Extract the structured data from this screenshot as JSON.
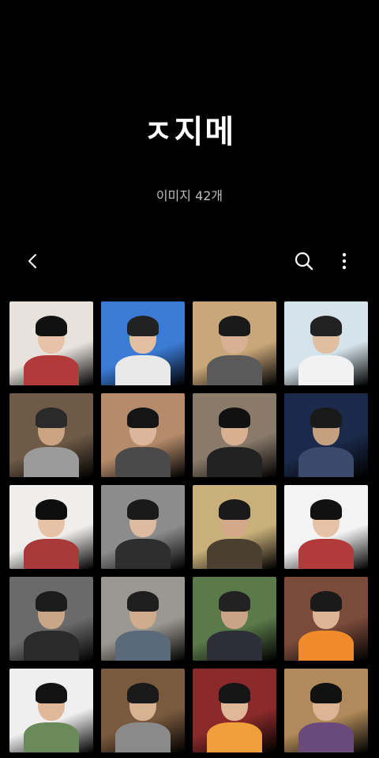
{
  "album": {
    "title": "ㅈ지메",
    "count_label": "이미지 42개"
  },
  "toolbar": {
    "back_icon": "back-arrow-icon",
    "search_icon": "search-icon",
    "more_icon": "more-vertical-icon"
  },
  "thumbnails": [
    {
      "bg": "#e8e2dc",
      "hair": "#111",
      "body": "#b33a3a",
      "skin": "#e6c3a8"
    },
    {
      "bg": "#3b7bd6",
      "hair": "#222",
      "body": "#e9e9e9",
      "skin": "#e2bfa0"
    },
    {
      "bg": "#c9a77a",
      "hair": "#1a1a1a",
      "body": "#5a5a5a",
      "skin": "#d8b195"
    },
    {
      "bg": "#d5e3ea",
      "hair": "#222",
      "body": "#f2f2f2",
      "skin": "#e0bea0"
    },
    {
      "bg": "#6e5a46",
      "hair": "#2a2a2a",
      "body": "#9b9b9b",
      "skin": "#c9a382"
    },
    {
      "bg": "#b58b6b",
      "hair": "#151515",
      "body": "#4a4a4a",
      "skin": "#dcb69a"
    },
    {
      "bg": "#8a7a6a",
      "hair": "#111",
      "body": "#222",
      "skin": "#d6b090"
    },
    {
      "bg": "#1b2a4a",
      "hair": "#1a1a1a",
      "body": "#3b4a6a",
      "skin": "#c5a080"
    },
    {
      "bg": "#f0eeec",
      "hair": "#0e0e0e",
      "body": "#a83a3a",
      "skin": "#e6c3a6"
    },
    {
      "bg": "#8c8c8c",
      "hair": "#1a1a1a",
      "body": "#2e2e2e",
      "skin": "#dcbba0"
    },
    {
      "bg": "#c9b07a",
      "hair": "#1a1a1a",
      "body": "#4b4030",
      "skin": "#d3a989"
    },
    {
      "bg": "#f3f3f3",
      "hair": "#111",
      "body": "#b33a3a",
      "skin": "#e5c2a5"
    },
    {
      "bg": "#6a6a6a",
      "hair": "#1c1c1c",
      "body": "#2a2a2a",
      "skin": "#c8a688"
    },
    {
      "bg": "#9a9890",
      "hair": "#1f1f1f",
      "body": "#5a6a7a",
      "skin": "#d0ac8e"
    },
    {
      "bg": "#5a7a4a",
      "hair": "#222",
      "body": "#2e2e38",
      "skin": "#c9a487"
    },
    {
      "bg": "#7a4a3a",
      "hair": "#1a1a1a",
      "body": "#f08a2a",
      "skin": "#dcb496"
    },
    {
      "bg": "#efefef",
      "hair": "#121212",
      "body": "#6a8a5a",
      "skin": "#dfb89a"
    },
    {
      "bg": "#7a5a3e",
      "hair": "#1a1a1a",
      "body": "#8a8a8a",
      "skin": "#d7b293"
    },
    {
      "bg": "#8a2a2a",
      "hair": "#151515",
      "body": "#f0a03a",
      "skin": "#e0b898"
    },
    {
      "bg": "#b08a5a",
      "hair": "#111",
      "body": "#6a4a7a",
      "skin": "#dcb597"
    }
  ]
}
